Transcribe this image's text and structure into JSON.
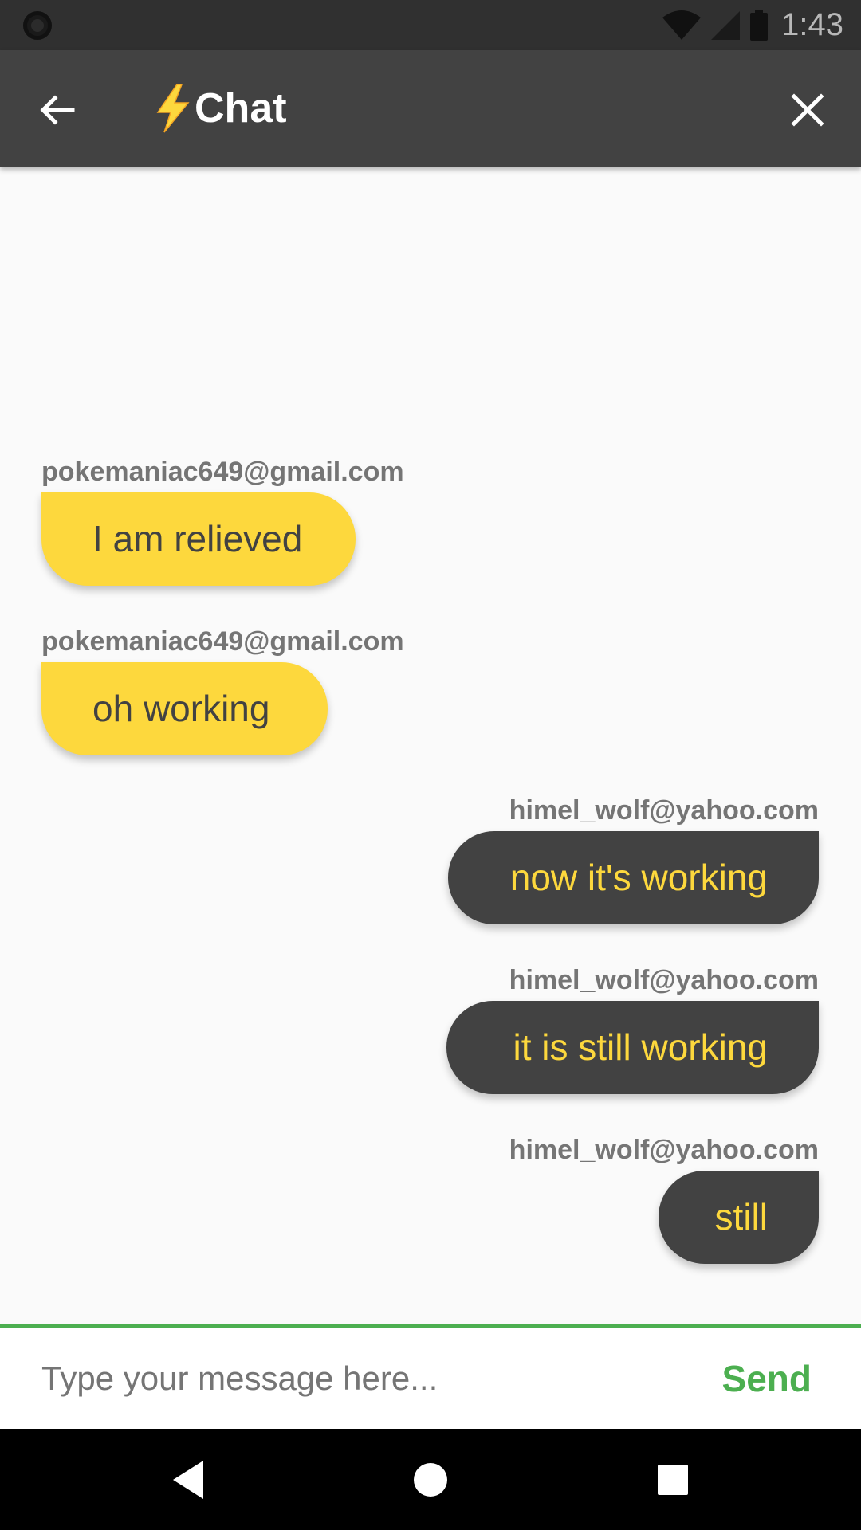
{
  "status_bar": {
    "time": "1:43",
    "icons": [
      "circle-indicator-icon",
      "wifi-icon",
      "signal-icon",
      "battery-icon"
    ]
  },
  "app_bar": {
    "title": "Chat",
    "title_icon": "lightning-bolt-icon",
    "back_icon": "arrow-back-icon",
    "close_icon": "close-icon"
  },
  "messages": [
    {
      "sender": "pokemaniac649@gmail.com",
      "text": "I am relieved",
      "is_me": false
    },
    {
      "sender": "pokemaniac649@gmail.com",
      "text": "oh working",
      "is_me": false
    },
    {
      "sender": "himel_wolf@yahoo.com",
      "text": "now it's working",
      "is_me": true
    },
    {
      "sender": "himel_wolf@yahoo.com",
      "text": "it is still working",
      "is_me": true
    },
    {
      "sender": "himel_wolf@yahoo.com",
      "text": "still",
      "is_me": true
    }
  ],
  "composer": {
    "placeholder": "Type your message here...",
    "value": "",
    "send_label": "Send"
  },
  "nav_bar": {
    "icons": [
      "nav-back-icon",
      "nav-home-icon",
      "nav-recents-icon"
    ]
  },
  "colors": {
    "app_bar": "#424242",
    "status_bar": "#303030",
    "accent_yellow": "#fdd83d",
    "dark_bubble": "#424242",
    "send_green": "#4caf50",
    "background": "#fafafa",
    "sender_text": "#757575"
  }
}
